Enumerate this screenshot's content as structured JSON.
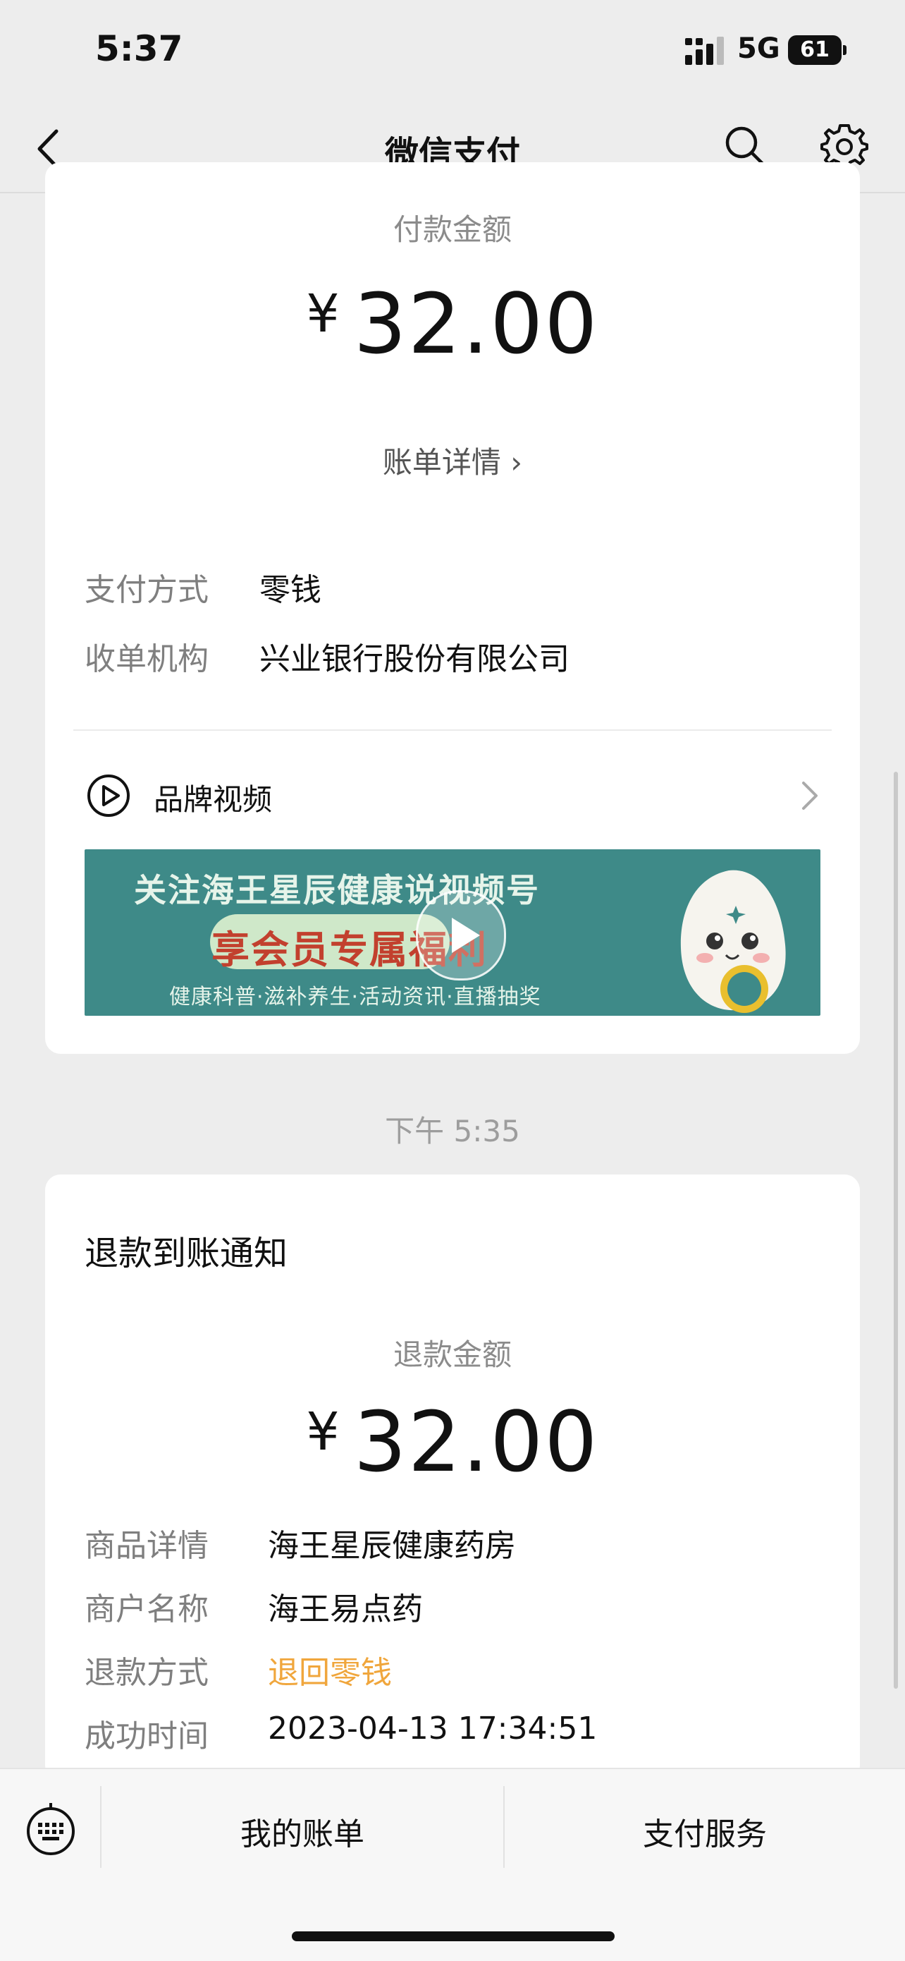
{
  "status_bar": {
    "time": "5:37",
    "network": "5G",
    "battery": "61"
  },
  "nav": {
    "title": "微信支付",
    "back_icon": "chevron-left-icon",
    "search_icon": "search-icon",
    "settings_icon": "gear-icon"
  },
  "payment_card": {
    "amount_label": "付款金额",
    "currency": "¥",
    "amount": "32.00",
    "bill_detail": "账单详情 ›",
    "rows": [
      {
        "label": "支付方式",
        "value": "零钱"
      },
      {
        "label": "收单机构",
        "value": "兴业银行股份有限公司"
      }
    ],
    "brand_video": {
      "label": "品牌视频"
    },
    "banner": {
      "line1": "关注海王星辰健康说视频号",
      "line2": "享会员专属福利",
      "line3": "健康科普·滋补养生·活动资讯·直播抽奖"
    }
  },
  "time_separator": "下午 5:35",
  "refund_card": {
    "title": "退款到账通知",
    "amount_label": "退款金额",
    "currency": "¥",
    "amount": "32.00",
    "rows": [
      {
        "label": "商品详情",
        "value": "海王星辰健康药房"
      },
      {
        "label": "商户名称",
        "value": "海王易点药"
      },
      {
        "label": "退款方式",
        "value": "退回零钱",
        "color": "#f0a63c"
      },
      {
        "label": "成功时间",
        "value": "2023-04-13 17:34:51"
      }
    ]
  },
  "bottom_bar": {
    "tab1": "我的账单",
    "tab2": "支付服务",
    "keyboard_icon": "keyboard-icon"
  }
}
